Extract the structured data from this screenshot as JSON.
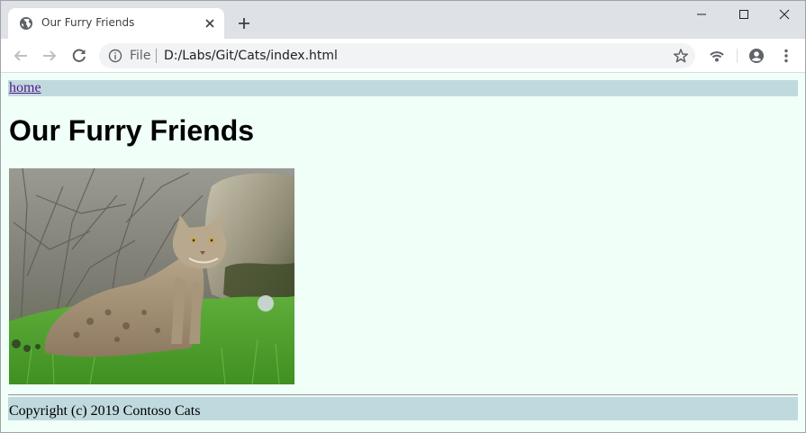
{
  "browser": {
    "tab": {
      "title": "Our Furry Friends"
    },
    "address": {
      "scheme_label": "File",
      "url": "D:/Labs/Git/Cats/index.html"
    }
  },
  "page": {
    "nav": {
      "home_label": "home"
    },
    "heading": "Our Furry Friends",
    "footer": "Copyright (c) 2019 Contoso Cats"
  },
  "colors": {
    "page_background": "#f0fff8",
    "bar_background": "#c0d9de",
    "visited_link": "#551a8b",
    "chrome_frame": "#dee1e6"
  },
  "icons": {
    "favicon": "globe-icon",
    "tab_close": "close-icon",
    "new_tab": "plus-icon",
    "back": "arrow-left-icon",
    "forward": "arrow-right-icon",
    "reload": "reload-icon",
    "site_info": "info-icon",
    "bookmark": "star-icon",
    "cast": "cast-icon",
    "account": "account-icon",
    "menu": "kebab-menu-icon"
  }
}
